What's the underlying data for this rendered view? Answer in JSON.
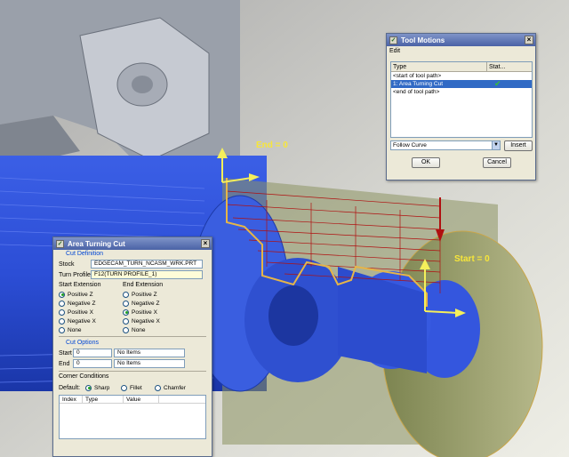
{
  "scene": {
    "end_label": "End = 0",
    "start_label": "Start = 0"
  },
  "tool_motions": {
    "title": "Tool Motions",
    "menu_edit": "Edit",
    "col_type": "Type",
    "col_status": "Stat...",
    "rows": [
      {
        "type": "<start of tool path>",
        "status": ""
      },
      {
        "type": "1: Area Turning Cut",
        "status": "✔"
      },
      {
        "type": "<end of tool path>",
        "status": ""
      }
    ],
    "combo_value": "Follow Curve",
    "insert_label": "Insert",
    "ok_label": "OK",
    "cancel_label": "Cancel"
  },
  "area_turning": {
    "title": "Area Turning Cut",
    "cut_definition": "Cut Definition",
    "stock_label": "Stock",
    "stock_value": "EDGECAM_TURN_NCASM_WRK.PRT",
    "turn_profile_label": "Turn Profile",
    "turn_profile_value": "F12(TURN PROFILE_1)",
    "start_extension": "Start Extension",
    "end_extension": "End Extension",
    "start_options": [
      "Positive Z",
      "Negative Z",
      "Positive X",
      "Negative X",
      "None"
    ],
    "start_selected": "Positive Z",
    "end_options": [
      "Positive Z",
      "Negative Z",
      "Positive X",
      "Negative X",
      "None"
    ],
    "end_selected": "Positive X",
    "cut_options": "Cut Options",
    "start_row_label": "Start",
    "start_row_value": "0",
    "start_row_items": "No Items",
    "end_row_label": "End",
    "end_row_value": "0",
    "end_row_items": "No Items",
    "corner_conditions": "Corner Conditions",
    "default_label": "Default:",
    "corner_options": [
      "Sharp",
      "Fillet",
      "Chamfer"
    ],
    "corner_selected": "Sharp",
    "table_cols": [
      "Index",
      "Type",
      "Value"
    ]
  }
}
